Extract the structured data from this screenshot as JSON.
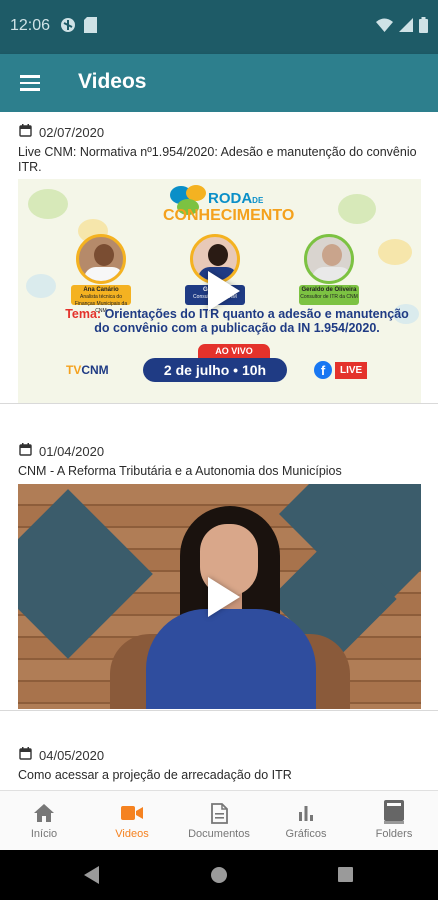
{
  "status_bar": {
    "time": "12:06",
    "icons": [
      "vpn-icon",
      "sim-icon",
      "wifi-icon",
      "signal-icon",
      "battery-icon"
    ]
  },
  "app_bar": {
    "title": "Videos",
    "menu_icon": "hamburger-menu-icon"
  },
  "videos": [
    {
      "date": "02/07/2020",
      "title": "Live CNM: Normativa nº1.954/2020: Adesão e manutenção do convênio ITR.",
      "thumbnail": {
        "brand": "RODA",
        "brand_de": "DE",
        "brand_sub": "CONHECIMENTO",
        "speaker_left_name": "Ana Canário",
        "speaker_left_role": "Analista técnica do Finanças Municipais da CNM",
        "speaker_mid_name": "Gabriela",
        "speaker_mid_role": "Consultora da CNM",
        "speaker_right_name": "Geraldo de Oliveira",
        "speaker_right_role": "Consultor de ITR da CNM",
        "tema_label": "Tema:",
        "tema_text": "Orientações do ITR quanto a adesão e manutenção do convênio com a publicação da IN 1.954/2020.",
        "ao_vivo": "AO VIVO",
        "date_pill": "2 de julho • 10h",
        "tv": "TV",
        "cnm": "CNM",
        "fb": "f",
        "live": "LIVE"
      }
    },
    {
      "date": "01/04/2020",
      "title": "CNM - A Reforma Tributária e a Autonomia dos Municípios"
    },
    {
      "date": "04/05/2020",
      "title": "Como acessar a projeção de arrecadação do ITR"
    }
  ],
  "bottom_nav": [
    {
      "label": "Início",
      "icon": "home-icon",
      "active": false
    },
    {
      "label": "Videos",
      "icon": "videocam-icon",
      "active": true
    },
    {
      "label": "Documentos",
      "icon": "document-icon",
      "active": false
    },
    {
      "label": "Gráficos",
      "icon": "bar-chart-icon",
      "active": false
    },
    {
      "label": "Folders",
      "icon": "book-icon",
      "active": false
    }
  ],
  "colors": {
    "status_bar": "#1e5b67",
    "app_bar": "#2d7f8d",
    "active_tab": "#f58220",
    "inactive_tab": "#777777"
  }
}
